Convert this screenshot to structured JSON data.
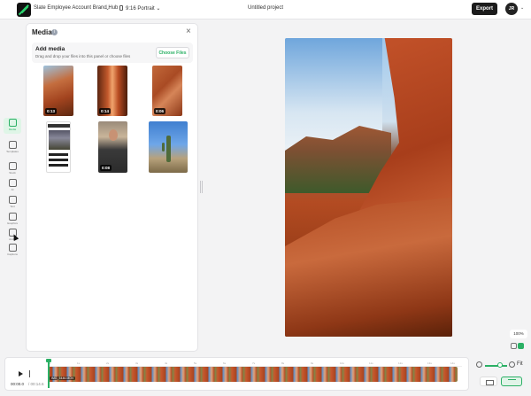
{
  "topbar": {
    "brand": "Slate Employee Account Brand Hub",
    "aspect": "9:16 Portrait",
    "project_title": "Untitled project",
    "export_label": "Export",
    "avatar_initials": "JR"
  },
  "sidebar": {
    "items": [
      {
        "label": "Media",
        "icon": "media-icon",
        "active": true
      },
      {
        "label": "Templates",
        "icon": "templates-icon"
      },
      {
        "label": "Stock",
        "icon": "stock-icon"
      },
      {
        "label": "AI",
        "icon": "ai-icon"
      },
      {
        "label": "Text",
        "icon": "text-icon"
      },
      {
        "label": "Graphics",
        "icon": "graphics-icon"
      },
      {
        "label": "Audio",
        "icon": "audio-icon"
      },
      {
        "label": "Captions",
        "icon": "captions-icon"
      }
    ]
  },
  "media_panel": {
    "title": "Media",
    "add_title": "Add media",
    "add_hint": "Drag and drop your files into this panel or choose files",
    "choose_label": "Choose Files",
    "items": [
      {
        "duration": "0:13",
        "kind": "rock1"
      },
      {
        "duration": "0:14",
        "kind": "rock2"
      },
      {
        "duration": "0:06",
        "kind": "rock3"
      },
      {
        "duration": "",
        "kind": "screen"
      },
      {
        "duration": "0:08",
        "kind": "person"
      },
      {
        "duration": "",
        "kind": "cactus"
      }
    ]
  },
  "canvas": {
    "zoom": "100%"
  },
  "timeline": {
    "current_time": "00:00.0",
    "duration": "/ 00:14.6",
    "track_label": "IMG_5446.MOV",
    "ticks": [
      "0s",
      "1s",
      "2s",
      "3s",
      "4s",
      "5s",
      "6s",
      "7s",
      "8s",
      "9s",
      "10s",
      "11s",
      "12s",
      "13s",
      "14s"
    ],
    "fit_label": "Fit"
  },
  "colors": {
    "accent": "#2bb065",
    "dark": "#1b1b1b"
  }
}
